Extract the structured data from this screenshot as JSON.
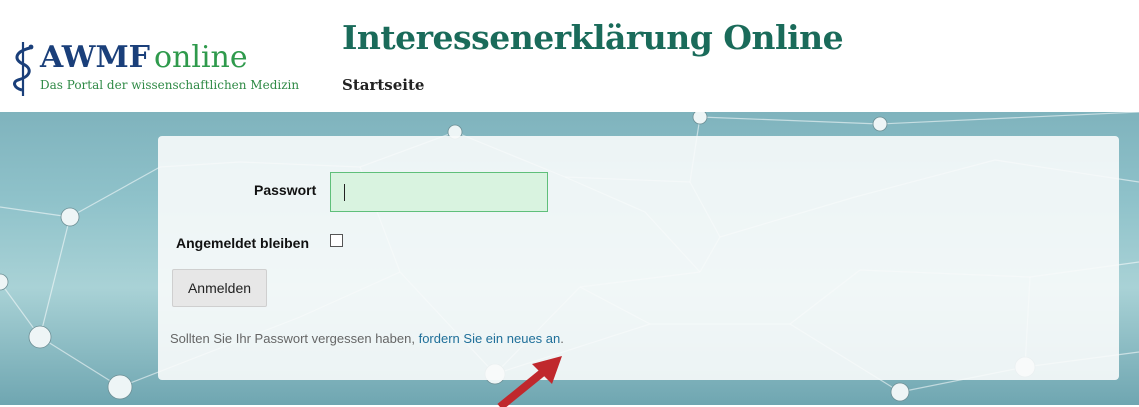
{
  "header": {
    "logo": {
      "brand": "AWMF",
      "suffix": "online",
      "tagline": "Das Portal der wissenschaftlichen Medizin",
      "icon": "caduceus-icon"
    },
    "app_title": "Interessenerklärung Online",
    "nav": {
      "home_label": "Startseite"
    }
  },
  "login": {
    "password_label": "Passwort",
    "password_value": "",
    "remember_label": "Angemeldet bleiben",
    "remember_checked": false,
    "submit_label": "Anmelden",
    "forgot_text": "Sollten Sie Ihr Passwort vergessen haben, ",
    "forgot_link": "fordern Sie ein neues an",
    "forgot_end": "."
  },
  "annotation": {
    "arrow_color": "#c0282d"
  },
  "colors": {
    "title": "#1a6b5a",
    "brand_blue": "#1a3f7a",
    "brand_green": "#2f9a4c",
    "link": "#1f6f99",
    "input_bg": "#d9f3e0",
    "input_border": "#5fbf7a"
  }
}
